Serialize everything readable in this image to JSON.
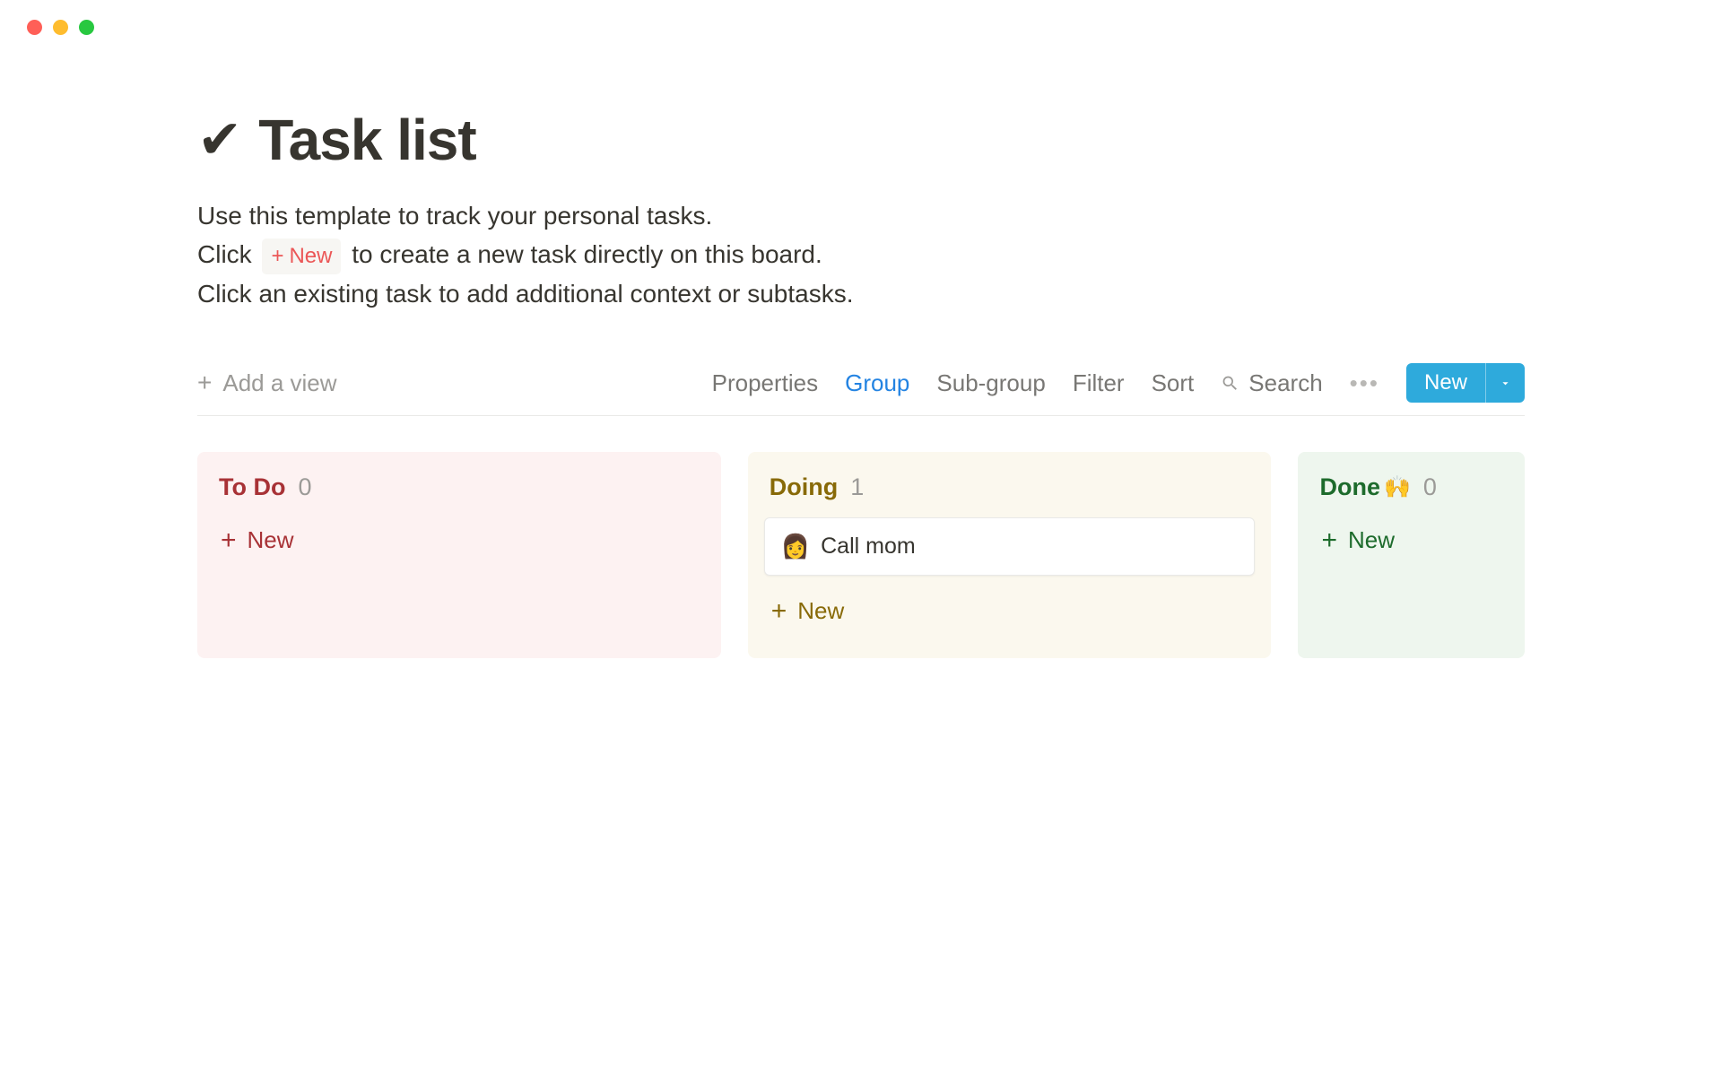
{
  "page": {
    "icon": "✔",
    "title": "Task list",
    "desc_line1": "Use this template to track your personal tasks.",
    "desc_line2_a": "Click",
    "desc_line2_badge_plus": "+",
    "desc_line2_badge_text": "New",
    "desc_line2_b": "to create a new task directly on this board.",
    "desc_line3": "Click an existing task to add additional context or subtasks."
  },
  "toolbar": {
    "add_view": "Add a view",
    "properties": "Properties",
    "group": "Group",
    "sub_group": "Sub-group",
    "filter": "Filter",
    "sort": "Sort",
    "search": "Search",
    "more": "•••",
    "new_button": "New"
  },
  "board": {
    "columns": [
      {
        "id": "todo",
        "title": "To Do",
        "count": "0",
        "new_label": "New"
      },
      {
        "id": "doing",
        "title": "Doing",
        "count": "1",
        "new_label": "New",
        "cards": [
          {
            "emoji": "👩",
            "title": "Call mom"
          }
        ]
      },
      {
        "id": "done",
        "title": "Done",
        "emoji": "🙌",
        "count": "0",
        "new_label": "New"
      }
    ]
  }
}
